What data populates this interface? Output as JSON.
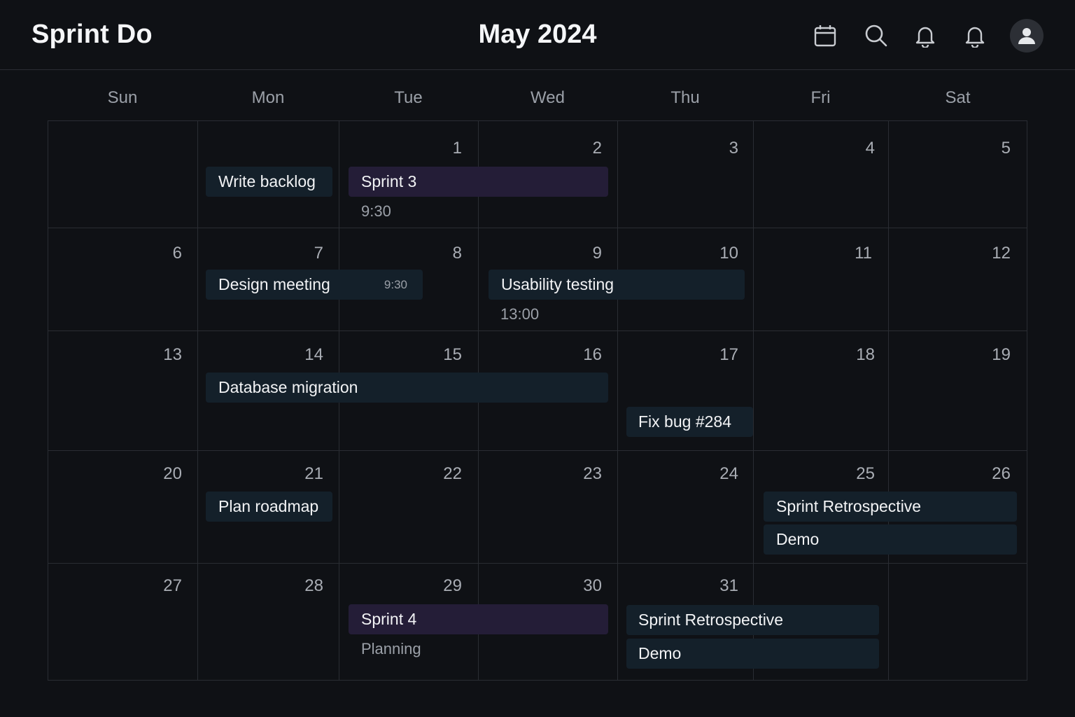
{
  "header": {
    "app_title": "Sprint Do",
    "month_title": "May 2024",
    "icons": [
      "calendar-icon",
      "search-icon",
      "bell-icon",
      "bell-icon",
      "user-icon"
    ]
  },
  "weekdays": [
    "Sun",
    "Mon",
    "Tue",
    "Wed",
    "Thu",
    "Fri",
    "Sat"
  ],
  "weeks": [
    [
      "",
      "",
      "1",
      "2",
      "3",
      "4",
      "5"
    ],
    [
      "6",
      "7",
      "8",
      "9",
      "10",
      "11",
      "12"
    ],
    [
      "13",
      "14",
      "15",
      "16",
      "17",
      "18",
      "19"
    ],
    [
      "20",
      "21",
      "22",
      "23",
      "24",
      "25",
      "26"
    ],
    [
      "27",
      "28",
      "29",
      "30",
      "31",
      "",
      ""
    ]
  ],
  "events": {
    "write_backlog": "Write backlog",
    "sprint3": "Sprint 3",
    "sprint3_time": "9:30",
    "design_meeting": "Design meeting",
    "design_meeting_time": "9:30",
    "usability_testing": "Usability testing",
    "usability_testing_time": "13:00",
    "database_migration": "Database migration",
    "fix_bug": "Fix bug #284",
    "plan_roadmap": "Plan roadmap",
    "retro_25": "Sprint Retrospective",
    "demo_25": "Demo",
    "sprint4": "Sprint 4",
    "sprint4_sub": "Planning",
    "retro_31": "Sprint Retrospective",
    "demo_31": "Demo"
  },
  "colors": {
    "background": "#0f1115",
    "event_teal": "#14202a",
    "event_purple": "#241d37",
    "gridline": "#2a2d33"
  }
}
